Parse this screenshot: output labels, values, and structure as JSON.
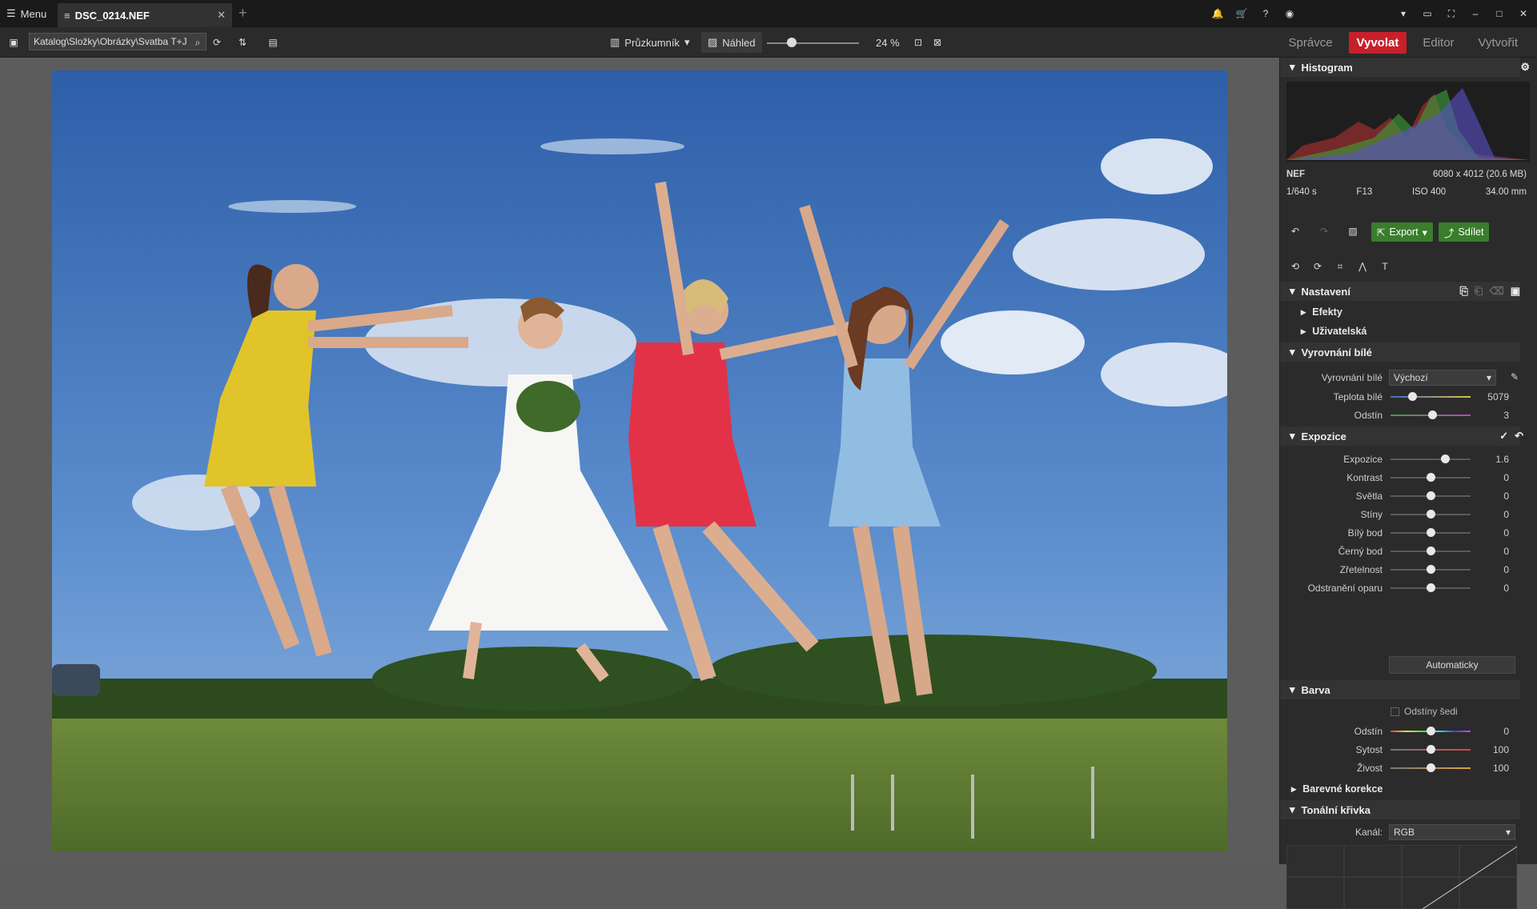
{
  "top": {
    "menu": "Menu",
    "tab_title": "DSC_0214.NEF",
    "tab_close": "✕",
    "new_tab": "+"
  },
  "toolbar": {
    "path": "Katalog\\Složky\\Obrázky\\Svatba T+J",
    "explorer": "Průzkumník",
    "preview": "Náhled",
    "zoom": "24 %"
  },
  "modes": [
    "Správce",
    "Vyvolat",
    "Editor",
    "Vytvořit"
  ],
  "info": {
    "format": "NEF",
    "dims": "6080 x 4012 (20.6 MB)",
    "shutter": "1/640 s",
    "aperture": "F13",
    "iso": "ISO 400",
    "focal": "34.00 mm"
  },
  "actions": {
    "export": "Export",
    "share": "Sdílet"
  },
  "sections": {
    "histogram": "Histogram",
    "settings": "Nastavení",
    "effects": "Efekty",
    "user": "Uživatelská",
    "wb": "Vyrovnání bílé",
    "exposure": "Expozice",
    "color": "Barva",
    "color_corr": "Barevné korekce",
    "tone": "Tonální křivka"
  },
  "wb": {
    "label": "Vyrovnání bílé",
    "value": "Výchozí",
    "temp_label": "Teplota bílé",
    "temp": "5079",
    "tint_label": "Odstín",
    "tint": "3",
    "temp_level": 0.27,
    "tint_level": 0.52
  },
  "exposure": [
    {
      "label": "Expozice",
      "value": "1.6",
      "level": 0.68
    },
    {
      "label": "Kontrast",
      "value": "0",
      "level": 0.5
    },
    {
      "label": "Světla",
      "value": "0",
      "level": 0.5
    },
    {
      "label": "Stíny",
      "value": "0",
      "level": 0.5
    },
    {
      "label": "Bílý bod",
      "value": "0",
      "level": 0.5
    },
    {
      "label": "Černý bod",
      "value": "0",
      "level": 0.5
    },
    {
      "label": "Zřetelnost",
      "value": "0",
      "level": 0.5
    },
    {
      "label": "Odstranění oparu",
      "value": "0",
      "level": 0.5
    }
  ],
  "auto": "Automaticky",
  "color": {
    "gray": "Odstíny šedi",
    "rows": [
      {
        "label": "Odstín",
        "value": "0",
        "level": 0.5
      },
      {
        "label": "Sytost",
        "value": "100",
        "level": 0.5
      },
      {
        "label": "Živost",
        "value": "100",
        "level": 0.5
      }
    ]
  },
  "tone": {
    "channel_label": "Kanál:",
    "channel": "RGB"
  }
}
